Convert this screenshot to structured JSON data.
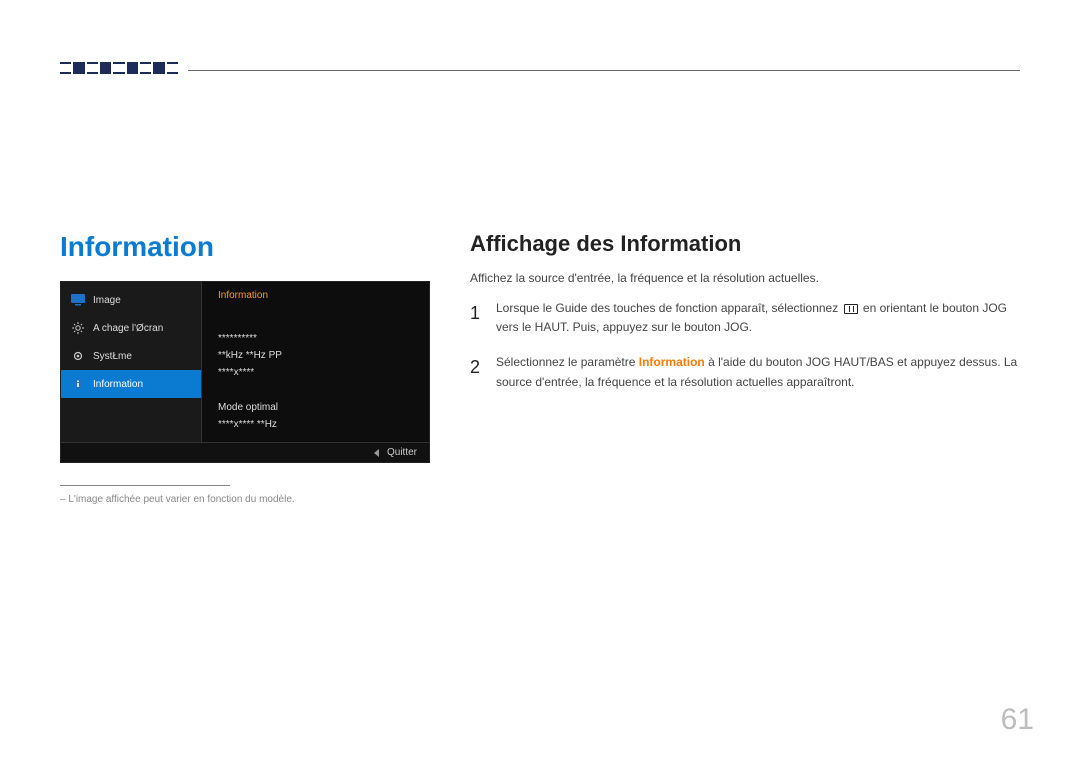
{
  "page_number": "61",
  "section_title": "Information",
  "subheading": "Affichage des Information",
  "intro": "Affichez la source d'entrée, la fréquence et la résolution actuelles.",
  "steps": {
    "s1": {
      "num": "1",
      "before": "Lorsque le Guide des touches de fonction apparaît, sélectionnez ",
      "after": " en orientant le bouton JOG vers le HAUT. Puis, appuyez sur le bouton JOG."
    },
    "s2": {
      "num": "2",
      "before": "Sélectionnez le paramètre ",
      "kw": "Information",
      "after": " à l'aide du bouton JOG HAUT/BAS et appuyez dessus. La source d'entrée, la fréquence et la résolution actuelles apparaîtront."
    }
  },
  "osd": {
    "menu": {
      "image": "Image",
      "affichage": "A chage l'Øcran",
      "systeme": "SystŁme",
      "information": "Information"
    },
    "panel": {
      "title": "Information",
      "line1": "**********",
      "line2": "**kHz **Hz PP",
      "line3": "****x****",
      "line4": "Mode optimal",
      "line5": "****x**** **Hz"
    },
    "footer": {
      "quitter": "Quitter"
    }
  },
  "footnote": "L'image affichée peut varier en fonction du modèle."
}
